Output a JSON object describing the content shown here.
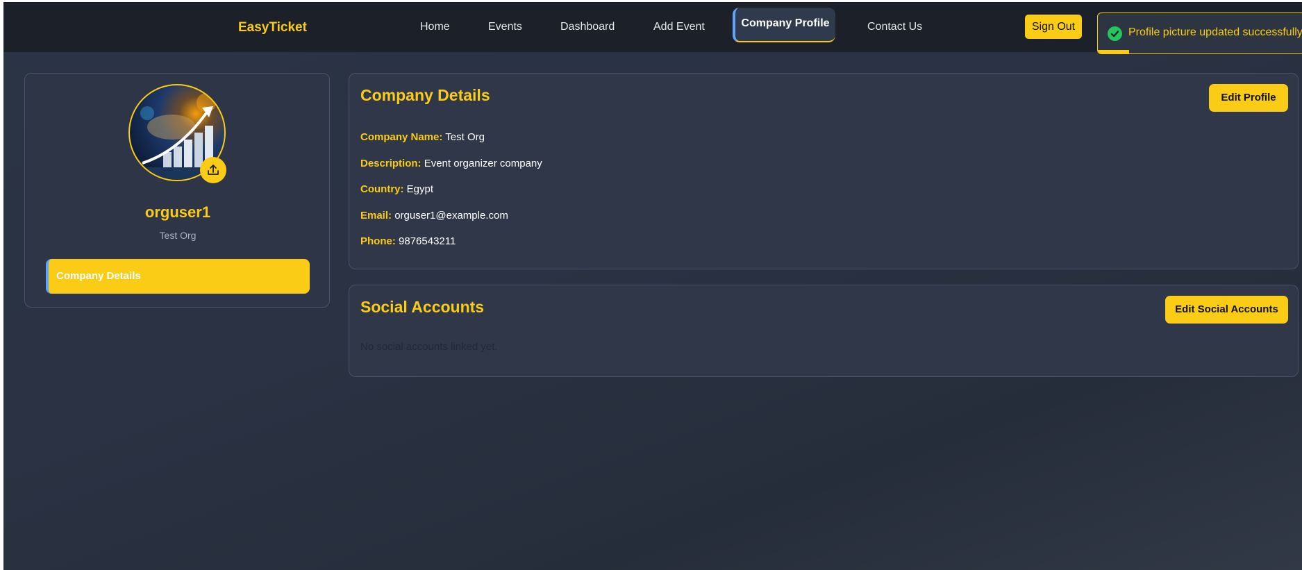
{
  "navbar": {
    "brand": "EasyTicket",
    "links": [
      "Home",
      "Events",
      "Dashboard",
      "Add Event",
      "Company Profile",
      "Contact Us"
    ],
    "active": "Company Profile",
    "sign_out": "Sign Out"
  },
  "toast": {
    "message": "Profile picture updated successfully!",
    "progress": 0.15,
    "icon": "check-circle-icon"
  },
  "profile": {
    "username": "orguser1",
    "org_name": "Test Org",
    "upload_icon": "upload-icon",
    "tab": "Company Details"
  },
  "company_details": {
    "title": "Company Details",
    "edit_button": "Edit Profile",
    "fields": [
      {
        "label": "Company Name:",
        "value": "Test Org"
      },
      {
        "label": "Description:",
        "value": "Event organizer company"
      },
      {
        "label": "Country:",
        "value": "Egypt"
      },
      {
        "label": "Email:",
        "value": "orguser1@example.com"
      },
      {
        "label": "Phone:",
        "value": "9876543211"
      }
    ]
  },
  "social_accounts": {
    "title": "Social Accounts",
    "edit_button": "Edit Social Accounts",
    "empty_text": "No social accounts linked yet."
  },
  "colors": {
    "accent": "#facc15",
    "nav_bg": "#1c2028",
    "page_bg": "#2b3445",
    "active_marker": "#60a5fa",
    "success": "#22c55e"
  }
}
